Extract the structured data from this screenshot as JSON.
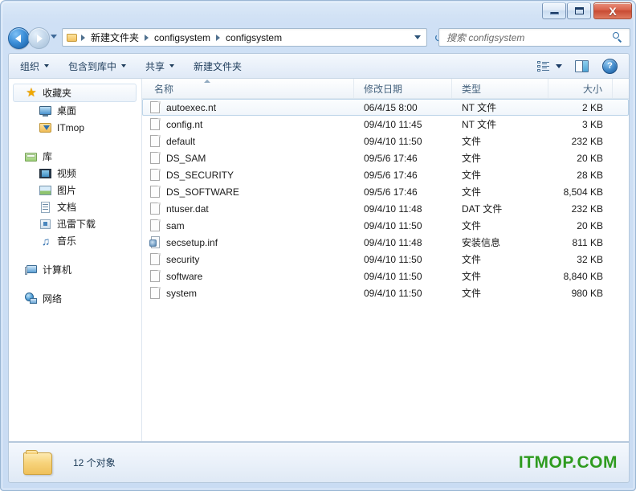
{
  "window": {
    "buttons": {
      "minimize": "–",
      "maximize": "□",
      "close": "X"
    }
  },
  "address_bar": {
    "back_label": "后退",
    "forward_label": "前进",
    "history_label": "最近浏览的位置",
    "refresh_label": "刷新",
    "breadcrumbs": [
      "新建文件夹",
      "configsystem",
      "configsystem"
    ]
  },
  "search": {
    "placeholder": "搜索 configsystem",
    "value": "",
    "icon": "search-icon"
  },
  "toolbar": {
    "items": [
      {
        "label": "组织",
        "has_caret": true
      },
      {
        "label": "包含到库中",
        "has_caret": true
      },
      {
        "label": "共享",
        "has_caret": true
      },
      {
        "label": "新建文件夹",
        "has_caret": false
      }
    ],
    "views_icon": "views-icon",
    "pane_icon": "preview-pane-icon",
    "help_icon": "help-icon",
    "help_glyph": "?"
  },
  "sidebar": {
    "groups": [
      {
        "label": "收藏夹",
        "icon": "star-icon",
        "highlighted": true,
        "children": [
          {
            "label": "桌面",
            "icon": "desktop-icon"
          },
          {
            "label": "ITmop",
            "icon": "folder-download-icon"
          }
        ]
      },
      {
        "label": "库",
        "icon": "library-icon",
        "highlighted": false,
        "children": [
          {
            "label": "视频",
            "icon": "video-icon"
          },
          {
            "label": "图片",
            "icon": "picture-icon"
          },
          {
            "label": "文档",
            "icon": "document-icon"
          },
          {
            "label": "迅雷下载",
            "icon": "download-icon"
          },
          {
            "label": "音乐",
            "icon": "music-icon"
          }
        ]
      },
      {
        "label": "计算机",
        "icon": "computer-icon",
        "highlighted": false,
        "children": []
      },
      {
        "label": "网络",
        "icon": "network-icon",
        "highlighted": false,
        "children": []
      }
    ]
  },
  "file_list": {
    "columns": [
      "名称",
      "修改日期",
      "类型",
      "大小"
    ],
    "sort_column": "名称",
    "sort_direction": "ascending",
    "rows": [
      {
        "name": "autoexec.nt",
        "date": "06/4/15 8:00",
        "type": "NT 文件",
        "size": "2 KB",
        "icon": "file-icon",
        "selected": true
      },
      {
        "name": "config.nt",
        "date": "09/4/10 11:45",
        "type": "NT 文件",
        "size": "3 KB",
        "icon": "file-icon",
        "selected": false
      },
      {
        "name": "default",
        "date": "09/4/10 11:50",
        "type": "文件",
        "size": "232 KB",
        "icon": "file-icon",
        "selected": false
      },
      {
        "name": "DS_SAM",
        "date": "09/5/6 17:46",
        "type": "文件",
        "size": "20 KB",
        "icon": "file-icon",
        "selected": false
      },
      {
        "name": "DS_SECURITY",
        "date": "09/5/6 17:46",
        "type": "文件",
        "size": "28 KB",
        "icon": "file-icon",
        "selected": false
      },
      {
        "name": "DS_SOFTWARE",
        "date": "09/5/6 17:46",
        "type": "文件",
        "size": "8,504 KB",
        "icon": "file-icon",
        "selected": false
      },
      {
        "name": "ntuser.dat",
        "date": "09/4/10 11:48",
        "type": "DAT 文件",
        "size": "232 KB",
        "icon": "file-icon",
        "selected": false
      },
      {
        "name": "sam",
        "date": "09/4/10 11:50",
        "type": "文件",
        "size": "20 KB",
        "icon": "file-icon",
        "selected": false
      },
      {
        "name": "secsetup.inf",
        "date": "09/4/10 11:48",
        "type": "安装信息",
        "size": "811 KB",
        "icon": "setup-information-icon",
        "selected": false
      },
      {
        "name": "security",
        "date": "09/4/10 11:50",
        "type": "文件",
        "size": "32 KB",
        "icon": "file-icon",
        "selected": false
      },
      {
        "name": "software",
        "date": "09/4/10 11:50",
        "type": "文件",
        "size": "8,840 KB",
        "icon": "file-icon",
        "selected": false
      },
      {
        "name": "system",
        "date": "09/4/10 11:50",
        "type": "文件",
        "size": "980 KB",
        "icon": "file-icon",
        "selected": false
      }
    ]
  },
  "status_bar": {
    "item_count_text": "12 个对象",
    "folder_icon": "folder-icon",
    "watermark": "ITMOP.COM",
    "watermark_color": "#2e9b1f"
  }
}
